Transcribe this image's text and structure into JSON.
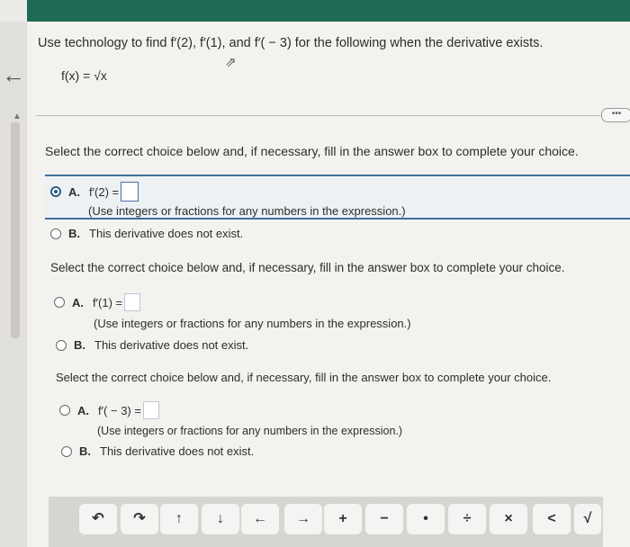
{
  "question": "Use technology to find f′(2), f′(1), and f′( − 3) for the following when the derivative exists.",
  "function": "f(x) = √x",
  "sections": [
    {
      "instruction": "Select the correct choice below and, if necessary, fill in the answer box to complete your choice.",
      "option_a_label": "A.",
      "option_a_expr": "f′(2) =",
      "option_a_hint": "(Use integers or fractions for any numbers in the expression.)",
      "option_b_label": "B.",
      "option_b_text": "This derivative does not exist.",
      "selected": "A"
    },
    {
      "instruction": "Select the correct choice below and, if necessary, fill in the answer box to complete your choice.",
      "option_a_label": "A.",
      "option_a_expr": "f′(1) =",
      "option_a_hint": "(Use integers or fractions for any numbers in the expression.)",
      "option_b_label": "B.",
      "option_b_text": "This derivative does not exist."
    },
    {
      "instruction": "Select the correct choice below and, if necessary, fill in the answer box to complete your choice.",
      "option_a_label": "A.",
      "option_a_expr": "f′( − 3) =",
      "option_a_hint": "(Use integers or fractions for any numbers in the expression.)",
      "option_b_label": "B.",
      "option_b_text": "This derivative does not exist."
    }
  ],
  "more_button": "•••",
  "toolbar_keys": [
    "↶",
    "↷",
    "↑",
    "↓",
    "←",
    "→",
    "+",
    "−",
    "•",
    "÷",
    "×",
    "<",
    "√"
  ],
  "colors": {
    "header": "#1f6a55",
    "selection_border": "#3e6f9a",
    "radio_selected": "#2c5b84"
  }
}
